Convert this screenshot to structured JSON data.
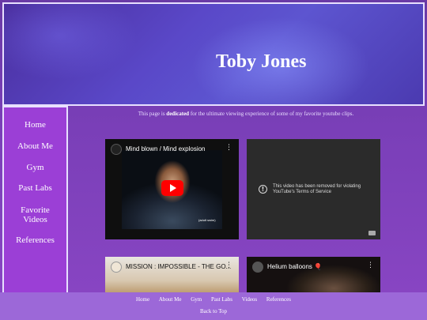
{
  "header": {
    "title": "Toby Jones"
  },
  "sidebar": {
    "items": [
      {
        "label": "Home"
      },
      {
        "label": "About Me"
      },
      {
        "label": "Gym"
      },
      {
        "label": "Past Labs"
      },
      {
        "label": "Favorite Videos"
      },
      {
        "label": "References"
      }
    ]
  },
  "main": {
    "intro_before": "This page is ",
    "intro_bold": "dedicated",
    "intro_after": " for the ultimate viewing experience of some of my favorite youtube clips.",
    "videos": [
      {
        "title": "Mind blown / Mind explosion",
        "badge": "(adult swim)"
      },
      {
        "removed_message": "This video has been removed for violating YouTube's Terms of Service"
      },
      {
        "title": "MISSION : IMPOSSIBLE - THE GO..."
      },
      {
        "title": "Helium balloons 🎈"
      }
    ]
  },
  "footer": {
    "links": [
      "Home",
      "About Me",
      "Gym",
      "Past Labs",
      "Videos",
      "References"
    ],
    "back_to_top": "Back to Top"
  }
}
